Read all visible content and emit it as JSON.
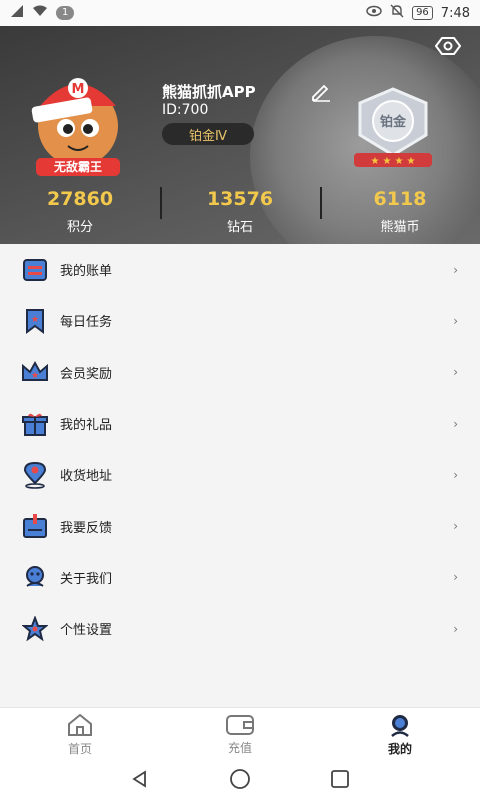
{
  "status": {
    "badge": "1",
    "battery": "96",
    "time": "7:48"
  },
  "header": {
    "username": "熊猫抓抓APP",
    "user_id": "ID:700",
    "level": "铂金Ⅳ",
    "avatar_text": "无敌霸王",
    "avatar_cap_letter": "M",
    "medal_label": "铂金"
  },
  "stats": [
    {
      "value": "27860",
      "label": "积分"
    },
    {
      "value": "13576",
      "label": "钻石"
    },
    {
      "value": "6118",
      "label": "熊猫币"
    }
  ],
  "menu": [
    {
      "label": "我的账单",
      "icon": "bill-icon"
    },
    {
      "label": "每日任务",
      "icon": "task-flag-icon"
    },
    {
      "label": "会员奖励",
      "icon": "crown-icon"
    },
    {
      "label": "我的礼品",
      "icon": "gift-icon"
    },
    {
      "label": "收货地址",
      "icon": "location-pin-icon"
    },
    {
      "label": "我要反馈",
      "icon": "feedback-icon"
    },
    {
      "label": "关于我们",
      "icon": "about-icon"
    },
    {
      "label": "个性设置",
      "icon": "star-settings-icon"
    }
  ],
  "tabs": [
    {
      "label": "首页",
      "icon": "home-icon"
    },
    {
      "label": "充值",
      "icon": "wallet-icon"
    },
    {
      "label": "我的",
      "icon": "profile-icon"
    }
  ],
  "colors": {
    "accent": "#f2c94c",
    "icon_blue": "#4a7fd6",
    "icon_dark": "#1f2a44",
    "icon_red": "#e84a4a"
  }
}
